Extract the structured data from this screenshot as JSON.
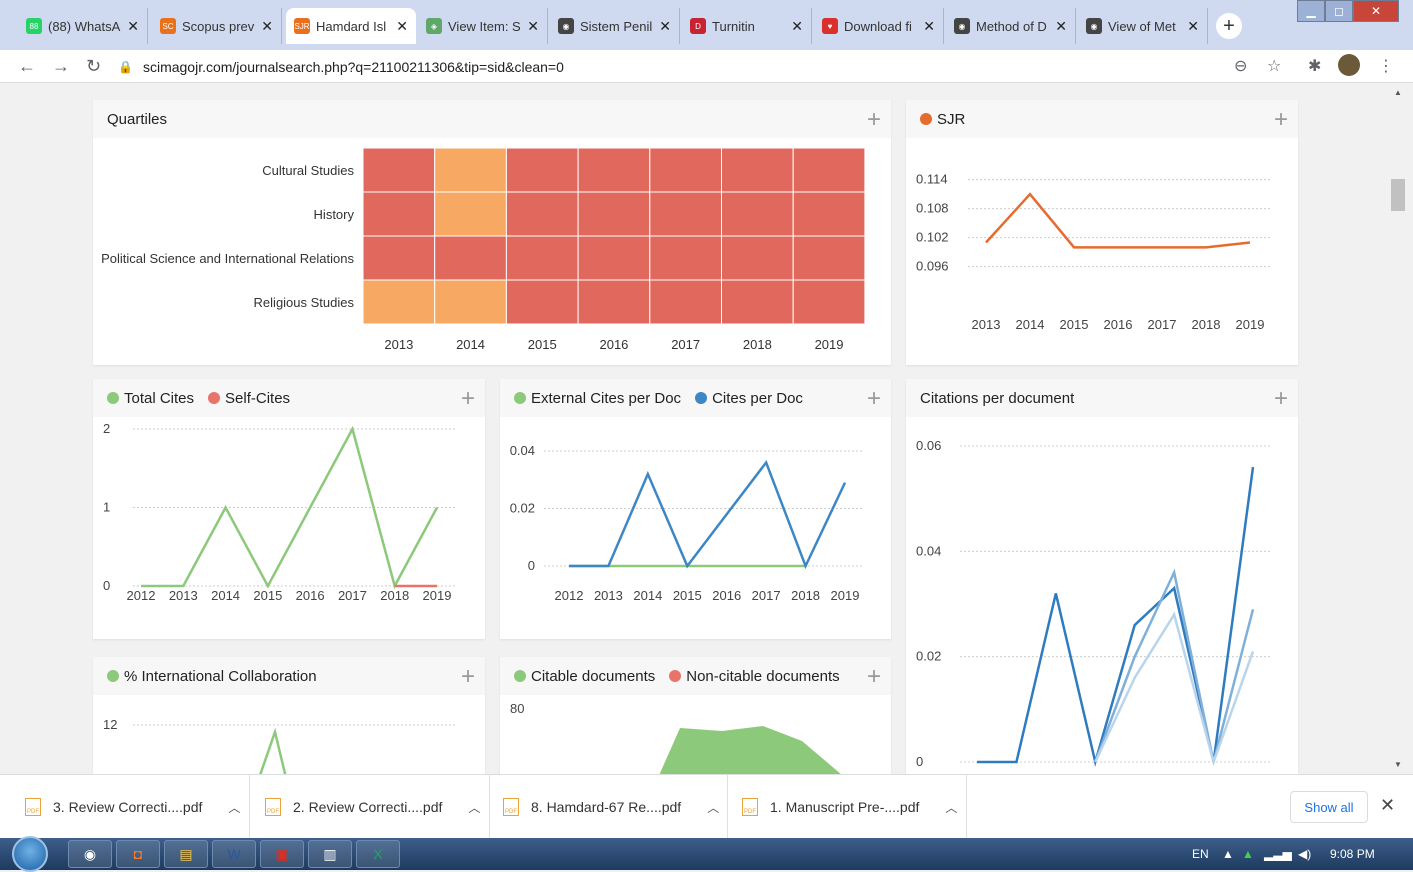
{
  "browser": {
    "tabs": [
      {
        "label": "(88) WhatsA",
        "icon": "whatsapp-icon",
        "color": "#25d366",
        "glyph": "88"
      },
      {
        "label": "Scopus prev",
        "icon": "scopus-icon",
        "color": "#e9711c",
        "glyph": "SC"
      },
      {
        "label": "Hamdard Isl",
        "icon": "sjr-icon",
        "color": "#e9711c",
        "glyph": "SJR"
      },
      {
        "label": "View Item: S",
        "icon": "dspace-icon",
        "color": "#5fa86a",
        "glyph": "◈"
      },
      {
        "label": "Sistem Penil",
        "icon": "globe-icon",
        "color": "#444444",
        "glyph": "◉"
      },
      {
        "label": "Turnitin",
        "icon": "turnitin-icon",
        "color": "#c82333",
        "glyph": "D"
      },
      {
        "label": "Download fi",
        "icon": "heart-icon",
        "color": "#d9302c",
        "glyph": "♥"
      },
      {
        "label": "Method of D",
        "icon": "globe-icon",
        "color": "#444444",
        "glyph": "◉"
      },
      {
        "label": "View of Met",
        "icon": "globe-icon",
        "color": "#444444",
        "glyph": "◉"
      }
    ],
    "url": "scimagojr.com/journalsearch.php?q=21100211306&tip=sid&clean=0"
  },
  "cards": {
    "quartiles": {
      "title": "Quartiles"
    },
    "sjr": {
      "legend": "SJR"
    },
    "cites": {
      "legend1": "Total Cites",
      "legend2": "Self-Cites"
    },
    "external": {
      "legend1": "External Cites per Doc",
      "legend2": "Cites per Doc"
    },
    "cpd": {
      "title": "Citations per document"
    },
    "intl": {
      "legend": "% International Collaboration"
    },
    "citable": {
      "legend1": "Citable documents",
      "legend2": "Non-citable documents"
    }
  },
  "colors": {
    "q1": "#f7a963",
    "q2": "#e0685c",
    "orange": "#e66b2e",
    "green": "#8cc97a",
    "red": "#e8736b",
    "blue": "#3d87c4"
  },
  "downloads": [
    {
      "name": "3. Review Correcti....pdf"
    },
    {
      "name": "2. Review Correcti....pdf"
    },
    {
      "name": "8. Hamdard-67 Re....pdf"
    },
    {
      "name": "1. Manuscript Pre-....pdf"
    }
  ],
  "show_all_label": "Show all",
  "taskbar": {
    "lang": "EN",
    "time": "9:08 PM"
  },
  "chart_data": [
    {
      "type": "heatmap",
      "title": "Quartiles",
      "rows": [
        "Cultural Studies",
        "History",
        "Political Science and International Relations",
        "Religious Studies"
      ],
      "columns": [
        "2013",
        "2014",
        "2015",
        "2016",
        "2017",
        "2018",
        "2019"
      ],
      "values": [
        [
          "Q2",
          "Q1",
          "Q2",
          "Q2",
          "Q2",
          "Q2",
          "Q2"
        ],
        [
          "Q2",
          "Q1",
          "Q2",
          "Q2",
          "Q2",
          "Q2",
          "Q2"
        ],
        [
          "Q2",
          "Q2",
          "Q2",
          "Q2",
          "Q2",
          "Q2",
          "Q2"
        ],
        [
          "Q1",
          "Q1",
          "Q2",
          "Q2",
          "Q2",
          "Q2",
          "Q2"
        ]
      ]
    },
    {
      "type": "line",
      "x": [
        "2013",
        "2014",
        "2015",
        "2016",
        "2017",
        "2018",
        "2019"
      ],
      "series": [
        {
          "name": "SJR",
          "values": [
            0.101,
            0.111,
            0.1,
            0.1,
            0.1,
            0.1,
            0.101
          ]
        }
      ],
      "yticks": [
        "0.114",
        "0.108",
        "0.102",
        "0.096"
      ],
      "ylim": [
        0.092,
        0.116
      ]
    },
    {
      "type": "line",
      "x": [
        "2012",
        "2013",
        "2014",
        "2015",
        "2016",
        "2017",
        "2018",
        "2019"
      ],
      "series": [
        {
          "name": "Total Cites",
          "values": [
            0,
            0,
            1,
            0,
            1,
            2,
            0,
            1
          ]
        },
        {
          "name": "Self-Cites",
          "values": [
            null,
            null,
            null,
            null,
            null,
            null,
            0,
            0
          ]
        }
      ],
      "yticks": [
        "2",
        "1",
        "0"
      ],
      "ylim": [
        0,
        2
      ]
    },
    {
      "type": "line",
      "x": [
        "2012",
        "2013",
        "2014",
        "2015",
        "2016",
        "2017",
        "2018",
        "2019"
      ],
      "series": [
        {
          "name": "External Cites per Doc",
          "values": [
            0,
            0,
            0,
            0,
            0,
            0,
            0,
            null
          ]
        },
        {
          "name": "Cites per Doc",
          "values": [
            0,
            0,
            0.032,
            0,
            0.018,
            0.036,
            0,
            0.029
          ]
        }
      ],
      "yticks": [
        "0.04",
        "0.02",
        "0"
      ],
      "ylim": [
        0,
        0.04
      ]
    },
    {
      "type": "line",
      "title": "Citations per document",
      "x": [
        "2012",
        "2013",
        "2014",
        "2015",
        "2016",
        "2017",
        "2018",
        "2019"
      ],
      "series": [
        {
          "values": [
            0,
            0,
            0.032,
            0,
            0.026,
            0.033,
            0,
            0.056
          ]
        },
        {
          "values": [
            null,
            null,
            null,
            0,
            0.02,
            0.036,
            0,
            0.029
          ]
        },
        {
          "values": [
            null,
            null,
            null,
            0,
            0.016,
            0.028,
            0,
            0.021
          ]
        }
      ],
      "yticks": [
        "0.06",
        "0.04",
        "0.02",
        "0"
      ],
      "ylim": [
        0,
        0.06
      ]
    },
    {
      "type": "line",
      "series": [
        {
          "name": "% International Collaboration",
          "values": [
            null,
            null,
            null,
            12
          ]
        }
      ],
      "yticks": [
        "12"
      ]
    },
    {
      "type": "area",
      "series": [
        {
          "name": "Citable documents"
        },
        {
          "name": "Non-citable documents"
        }
      ],
      "yticks": [
        "80"
      ]
    }
  ]
}
